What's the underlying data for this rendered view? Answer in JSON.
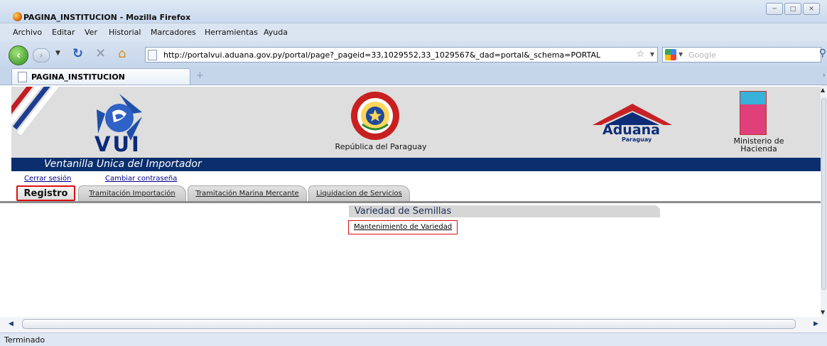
{
  "window": {
    "title": "PAGINA_INSTITUCION - Mozilla Firefox",
    "controls": [
      "─",
      "□",
      "✕"
    ]
  },
  "menu": [
    "Archivo",
    "Editar",
    "Ver",
    "Historial",
    "Marcadores",
    "Herramientas",
    "Ayuda"
  ],
  "nav": {
    "url": "http://portalvui.aduana.gov.py/portal/page?_pageid=33,1029552,33_1029567&_dad=portal&_schema=PORTAL",
    "search_placeholder": "Google"
  },
  "browser_tab": {
    "label": "PAGINA_INSTITUCION"
  },
  "header": {
    "vui_logo_text": "VUI",
    "country_text": "República del Paraguay",
    "aduana_text": "Aduana",
    "aduana_sub": "Paraguay",
    "ministerio_line1": "Ministerio de",
    "ministerio_line2": "Hacienda",
    "banner_text": "Ventanilla Unica del Importador"
  },
  "links": {
    "logout": "Cerrar sesión",
    "change_password": "Cambiar contraseña"
  },
  "page_tabs": [
    {
      "label": "Registro",
      "active": true
    },
    {
      "label": "Tramitación Importación",
      "active": false
    },
    {
      "label": "Tramitación Marina Mercante",
      "active": false
    },
    {
      "label": "Liquidacion de Servicios",
      "active": false
    }
  ],
  "section": {
    "title": "Variedad de Semillas",
    "items": [
      "Mantenimiento de Variedad"
    ]
  },
  "status": {
    "text": "Terminado"
  },
  "colors": {
    "banner": "#0b2f6e",
    "highlight": "#dd1111",
    "link": "#00008b"
  }
}
